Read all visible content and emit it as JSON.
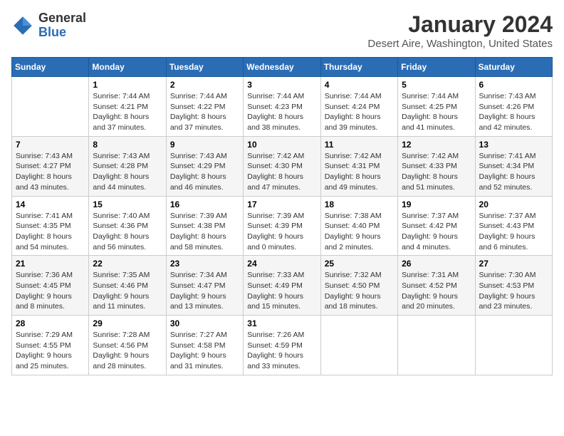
{
  "logo": {
    "text_general": "General",
    "text_blue": "Blue"
  },
  "header": {
    "month_year": "January 2024",
    "location": "Desert Aire, Washington, United States"
  },
  "weekdays": [
    "Sunday",
    "Monday",
    "Tuesday",
    "Wednesday",
    "Thursday",
    "Friday",
    "Saturday"
  ],
  "weeks": [
    [
      {
        "day": "",
        "info": ""
      },
      {
        "day": "1",
        "info": "Sunrise: 7:44 AM\nSunset: 4:21 PM\nDaylight: 8 hours\nand 37 minutes."
      },
      {
        "day": "2",
        "info": "Sunrise: 7:44 AM\nSunset: 4:22 PM\nDaylight: 8 hours\nand 37 minutes."
      },
      {
        "day": "3",
        "info": "Sunrise: 7:44 AM\nSunset: 4:23 PM\nDaylight: 8 hours\nand 38 minutes."
      },
      {
        "day": "4",
        "info": "Sunrise: 7:44 AM\nSunset: 4:24 PM\nDaylight: 8 hours\nand 39 minutes."
      },
      {
        "day": "5",
        "info": "Sunrise: 7:44 AM\nSunset: 4:25 PM\nDaylight: 8 hours\nand 41 minutes."
      },
      {
        "day": "6",
        "info": "Sunrise: 7:43 AM\nSunset: 4:26 PM\nDaylight: 8 hours\nand 42 minutes."
      }
    ],
    [
      {
        "day": "7",
        "info": "Sunrise: 7:43 AM\nSunset: 4:27 PM\nDaylight: 8 hours\nand 43 minutes."
      },
      {
        "day": "8",
        "info": "Sunrise: 7:43 AM\nSunset: 4:28 PM\nDaylight: 8 hours\nand 44 minutes."
      },
      {
        "day": "9",
        "info": "Sunrise: 7:43 AM\nSunset: 4:29 PM\nDaylight: 8 hours\nand 46 minutes."
      },
      {
        "day": "10",
        "info": "Sunrise: 7:42 AM\nSunset: 4:30 PM\nDaylight: 8 hours\nand 47 minutes."
      },
      {
        "day": "11",
        "info": "Sunrise: 7:42 AM\nSunset: 4:31 PM\nDaylight: 8 hours\nand 49 minutes."
      },
      {
        "day": "12",
        "info": "Sunrise: 7:42 AM\nSunset: 4:33 PM\nDaylight: 8 hours\nand 51 minutes."
      },
      {
        "day": "13",
        "info": "Sunrise: 7:41 AM\nSunset: 4:34 PM\nDaylight: 8 hours\nand 52 minutes."
      }
    ],
    [
      {
        "day": "14",
        "info": "Sunrise: 7:41 AM\nSunset: 4:35 PM\nDaylight: 8 hours\nand 54 minutes."
      },
      {
        "day": "15",
        "info": "Sunrise: 7:40 AM\nSunset: 4:36 PM\nDaylight: 8 hours\nand 56 minutes."
      },
      {
        "day": "16",
        "info": "Sunrise: 7:39 AM\nSunset: 4:38 PM\nDaylight: 8 hours\nand 58 minutes."
      },
      {
        "day": "17",
        "info": "Sunrise: 7:39 AM\nSunset: 4:39 PM\nDaylight: 9 hours\nand 0 minutes."
      },
      {
        "day": "18",
        "info": "Sunrise: 7:38 AM\nSunset: 4:40 PM\nDaylight: 9 hours\nand 2 minutes."
      },
      {
        "day": "19",
        "info": "Sunrise: 7:37 AM\nSunset: 4:42 PM\nDaylight: 9 hours\nand 4 minutes."
      },
      {
        "day": "20",
        "info": "Sunrise: 7:37 AM\nSunset: 4:43 PM\nDaylight: 9 hours\nand 6 minutes."
      }
    ],
    [
      {
        "day": "21",
        "info": "Sunrise: 7:36 AM\nSunset: 4:45 PM\nDaylight: 9 hours\nand 8 minutes."
      },
      {
        "day": "22",
        "info": "Sunrise: 7:35 AM\nSunset: 4:46 PM\nDaylight: 9 hours\nand 11 minutes."
      },
      {
        "day": "23",
        "info": "Sunrise: 7:34 AM\nSunset: 4:47 PM\nDaylight: 9 hours\nand 13 minutes."
      },
      {
        "day": "24",
        "info": "Sunrise: 7:33 AM\nSunset: 4:49 PM\nDaylight: 9 hours\nand 15 minutes."
      },
      {
        "day": "25",
        "info": "Sunrise: 7:32 AM\nSunset: 4:50 PM\nDaylight: 9 hours\nand 18 minutes."
      },
      {
        "day": "26",
        "info": "Sunrise: 7:31 AM\nSunset: 4:52 PM\nDaylight: 9 hours\nand 20 minutes."
      },
      {
        "day": "27",
        "info": "Sunrise: 7:30 AM\nSunset: 4:53 PM\nDaylight: 9 hours\nand 23 minutes."
      }
    ],
    [
      {
        "day": "28",
        "info": "Sunrise: 7:29 AM\nSunset: 4:55 PM\nDaylight: 9 hours\nand 25 minutes."
      },
      {
        "day": "29",
        "info": "Sunrise: 7:28 AM\nSunset: 4:56 PM\nDaylight: 9 hours\nand 28 minutes."
      },
      {
        "day": "30",
        "info": "Sunrise: 7:27 AM\nSunset: 4:58 PM\nDaylight: 9 hours\nand 31 minutes."
      },
      {
        "day": "31",
        "info": "Sunrise: 7:26 AM\nSunset: 4:59 PM\nDaylight: 9 hours\nand 33 minutes."
      },
      {
        "day": "",
        "info": ""
      },
      {
        "day": "",
        "info": ""
      },
      {
        "day": "",
        "info": ""
      }
    ]
  ]
}
